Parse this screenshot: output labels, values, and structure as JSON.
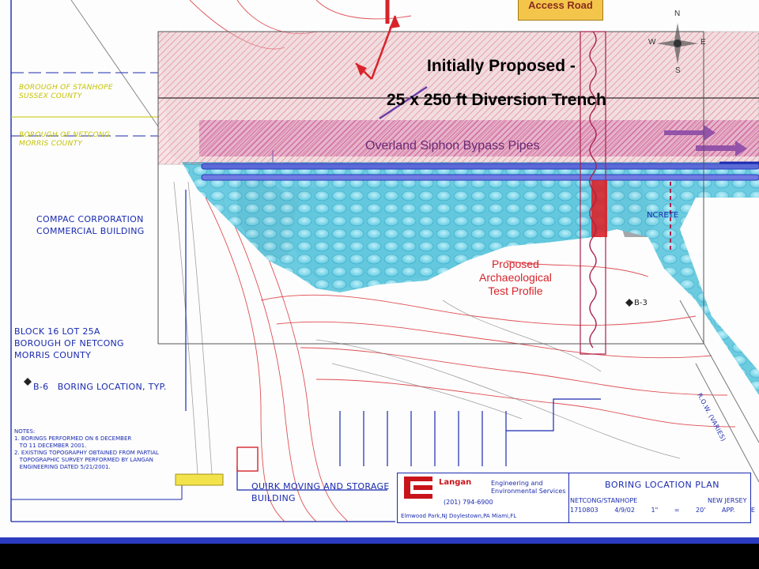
{
  "overlay": {
    "title_line1": "Initially Proposed -",
    "title_line2": "25 x 250 ft Diversion Trench",
    "siphon_label": "Overland Siphon Bypass Pipes",
    "test_profile_label": "Proposed\nArchaeological\nTest Profile",
    "access_road_label": "Access Road"
  },
  "compass": {
    "n": "N",
    "s": "S",
    "e": "E",
    "w": "W"
  },
  "map_labels": {
    "borough_stanhope": "BOROUGH OF STANHOPE\nSUSSEX COUNTY",
    "borough_netcong": "BOROUGH OF NETCONG\nMORRIS COUNTY",
    "compac": "COMPAC CORPORATION\nCOMMERCIAL BUILDING",
    "block_lot": "BLOCK 16 LOT 25A\nBOROUGH OF NETCONG\nMORRIS COUNTY",
    "boring_location": "B-6   BORING LOCATION, TYP.",
    "quirk": "QUIRK MOVING AND STORAGE\nBUILDING",
    "concrete": "NCRETE",
    "b3": "B-3",
    "row": "R.O.W. (VARIES)",
    "notes": "NOTES:\n1. BORINGS PERFORMED ON 6 DECEMBER\n   TO 11 DECEMBER 2001.\n2. EXISTING TOPOGRAPHY OBTAINED FROM PARTIAL\n   TOPOGRAPHIC SURVEY PERFORMED BY LANGAN\n   ENGINEERING DATED 5/21/2001."
  },
  "title_block": {
    "company": "Langan",
    "subtitle": "Engineering and\nEnvironmental Services",
    "phone": "(201) 794-6900",
    "offices": "Elmwood Park,NJ   Doylestown,PA   Miami,FL",
    "plan_title": "BORING LOCATION PLAN",
    "place_left": "NETCONG/STANHOPE",
    "place_right": "NEW JERSEY",
    "job_no": "1710803",
    "date": "4/9/02",
    "scale": "1\" = 20'",
    "figure": "APP. E"
  },
  "colors": {
    "water": "#5ec9e0",
    "trench_hatch": "#d8232a",
    "siphon": "#a13f9c",
    "pipe_blue": "#5b6ad6",
    "contour_red": "#d8232a",
    "label_blue": "#1a2bb0",
    "access_road": "#f3c64b"
  }
}
